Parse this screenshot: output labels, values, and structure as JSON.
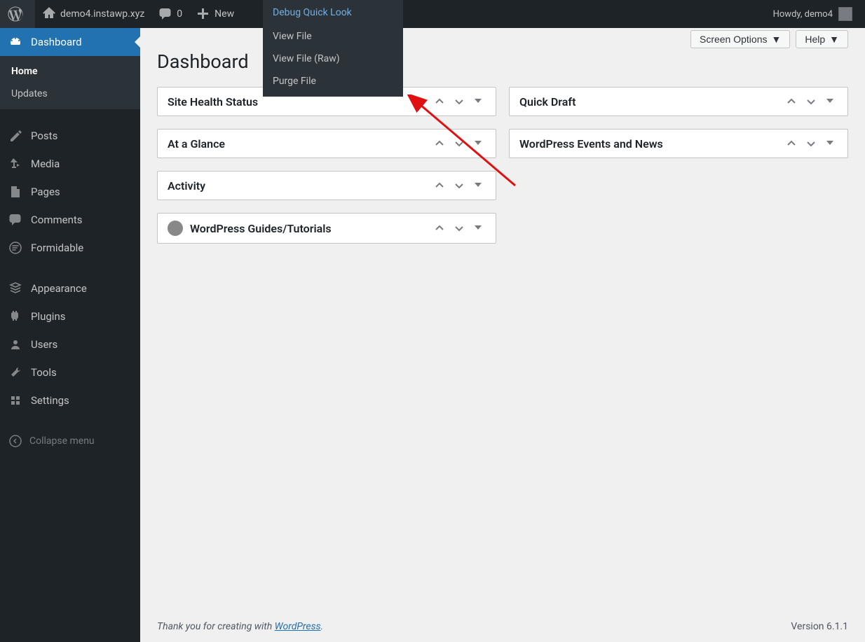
{
  "adminbar": {
    "site_name": "demo4.instawp.xyz",
    "comments": "0",
    "new": "New",
    "howdy": "Howdy, demo4"
  },
  "debug_menu": {
    "header": "Debug Quick Look",
    "items": [
      "View File",
      "View File (Raw)",
      "Purge File"
    ]
  },
  "sidebar": {
    "items": [
      {
        "label": "Dashboard",
        "icon": "dashboard-icon"
      },
      {
        "label": "Posts",
        "icon": "posts-icon"
      },
      {
        "label": "Media",
        "icon": "media-icon"
      },
      {
        "label": "Pages",
        "icon": "pages-icon"
      },
      {
        "label": "Comments",
        "icon": "comments-icon"
      },
      {
        "label": "Formidable",
        "icon": "formidable-icon"
      },
      {
        "label": "Appearance",
        "icon": "appearance-icon"
      },
      {
        "label": "Plugins",
        "icon": "plugins-icon"
      },
      {
        "label": "Users",
        "icon": "users-icon"
      },
      {
        "label": "Tools",
        "icon": "tools-icon"
      },
      {
        "label": "Settings",
        "icon": "settings-icon"
      }
    ],
    "submenu": [
      "Home",
      "Updates"
    ],
    "collapse": "Collapse menu"
  },
  "screen": {
    "options": "Screen Options",
    "help": "Help"
  },
  "page": {
    "title": "Dashboard"
  },
  "postboxes": {
    "left": [
      {
        "title": "Site Health Status"
      },
      {
        "title": "At a Glance"
      },
      {
        "title": "Activity"
      },
      {
        "title": "WordPress Guides/Tutorials",
        "has_icon": true
      }
    ],
    "right": [
      {
        "title": "Quick Draft"
      },
      {
        "title": "WordPress Events and News"
      }
    ]
  },
  "footer": {
    "thank_prefix": "Thank you for creating with ",
    "thank_link": "WordPress",
    "thank_suffix": ".",
    "version": "Version 6.1.1"
  }
}
